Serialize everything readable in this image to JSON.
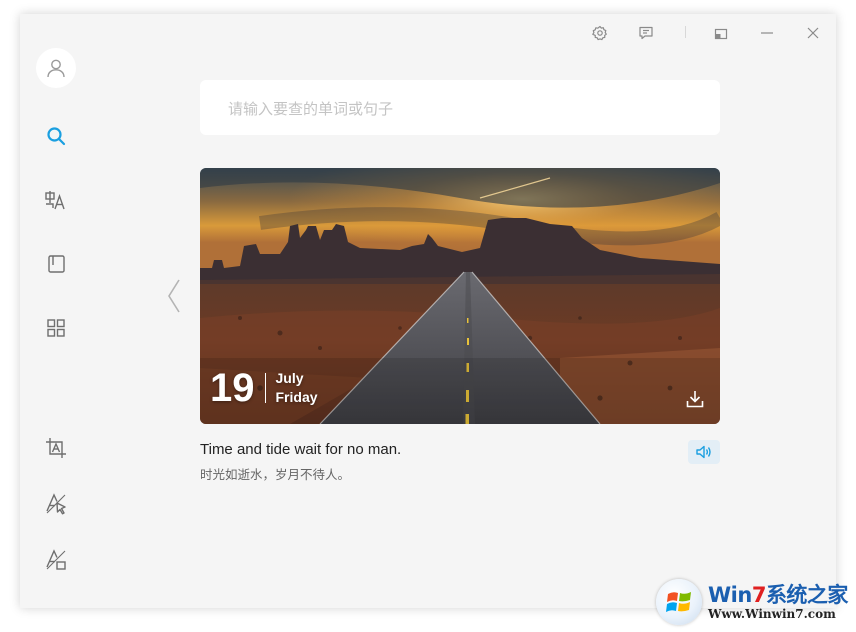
{
  "titlebar": {
    "settings_icon": "gear-icon",
    "feedback_icon": "message-square-icon",
    "mini_mode_icon": "window-restore-icon",
    "minimize_icon": "minimize-icon",
    "close_icon": "close-icon"
  },
  "sidebar": {
    "avatar_icon": "user-icon",
    "items": [
      {
        "id": "search",
        "icon": "search-icon",
        "active": true
      },
      {
        "id": "translate",
        "icon": "translate-icon",
        "active": false
      },
      {
        "id": "wordbook",
        "icon": "book-icon",
        "active": false
      },
      {
        "id": "apps",
        "icon": "grid-icon",
        "active": false
      }
    ],
    "bottom_items": [
      {
        "id": "screenshot-translate",
        "icon": "screenshot-text-icon"
      },
      {
        "id": "pointer-translate",
        "icon": "pointer-translate-icon"
      },
      {
        "id": "disable-translate",
        "icon": "disable-translate-icon"
      }
    ],
    "accent_color": "#1a9fe0"
  },
  "search": {
    "placeholder": "请输入要查的单词或句子",
    "value": ""
  },
  "daily": {
    "day": "19",
    "month": "July",
    "weekday": "Friday",
    "quote_en": "Time and tide wait for no man.",
    "quote_zh": "时光如逝水，岁月不待人。",
    "image": "desert-road-monument-valley"
  },
  "watermark": {
    "brand_part1": "Win",
    "brand_num": "7",
    "brand_part2": "系统之家",
    "url": "Www.Winwin7.com"
  }
}
